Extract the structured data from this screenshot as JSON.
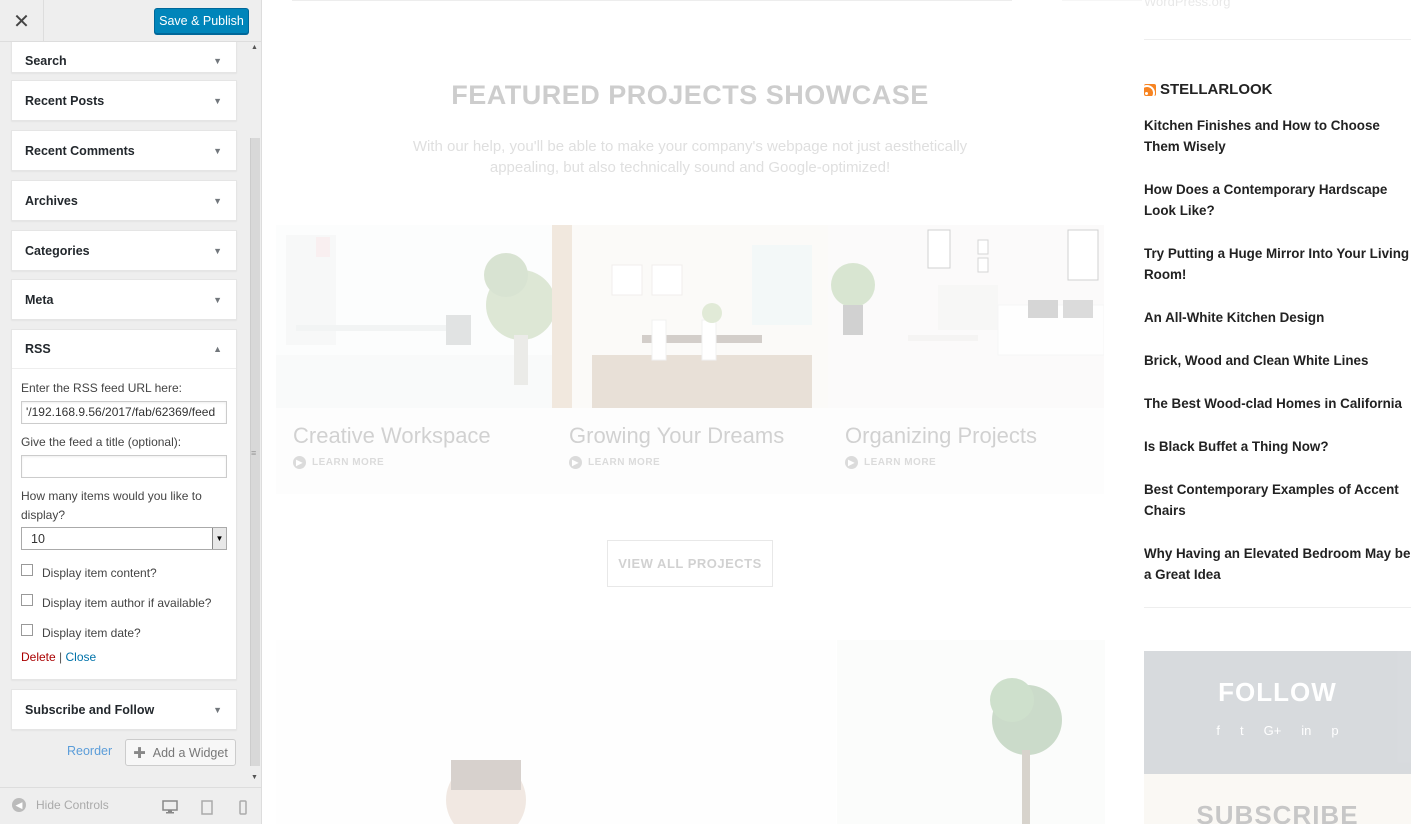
{
  "header": {
    "close_glyph": "✕",
    "save_label": "Save & Publish"
  },
  "widgets": [
    {
      "title": "Search",
      "arrow": "▼"
    },
    {
      "title": "Recent Posts",
      "arrow": "▼"
    },
    {
      "title": "Recent Comments",
      "arrow": "▼"
    },
    {
      "title": "Archives",
      "arrow": "▼"
    },
    {
      "title": "Categories",
      "arrow": "▼"
    },
    {
      "title": "Meta",
      "arrow": "▼"
    }
  ],
  "rss_widget": {
    "title": "RSS",
    "arrow": "▲",
    "url_label": "Enter the RSS feed URL here:",
    "url_value": "'/192.168.9.56/2017/fab/62369/feed",
    "title_label": "Give the feed a title (optional):",
    "title_value": "",
    "items_label": "How many items would you like to display?",
    "items_value": "10",
    "checkboxes": [
      {
        "label": "Display item content?",
        "checked": false
      },
      {
        "label": "Display item author if available?",
        "checked": false
      },
      {
        "label": "Display item date?",
        "checked": false
      }
    ],
    "delete_label": "Delete",
    "separator": "|",
    "close_label": "Close"
  },
  "subscribe_widget": {
    "title": "Subscribe and Follow",
    "arrow": "▼"
  },
  "actions": {
    "reorder_label": "Reorder",
    "add_widget_label": "Add a Widget"
  },
  "footer": {
    "hide_controls_label": "Hide Controls",
    "devices": [
      "desktop",
      "tablet",
      "mobile"
    ]
  },
  "preview": {
    "showcase_title": "FEATURED PROJECTS SHOWCASE",
    "showcase_subtitle": "With our help, you'll be able to make your company's webpage not just aesthetically appealing, but also technically sound and Google-optimized!",
    "projects": [
      {
        "title": "Creative Workspace",
        "more": "LEARN MORE"
      },
      {
        "title": "Growing Your Dreams",
        "more": "LEARN MORE"
      },
      {
        "title": "Organizing Projects",
        "more": "LEARN MORE"
      }
    ],
    "view_all_label": "VIEW ALL PROJECTS",
    "wordpress_link": "WordPress.org",
    "rss_feed_title": "STELLARLOOK",
    "rss_items": [
      "Kitchen Finishes and How to Choose Them Wisely",
      "How Does a Contemporary Hardscape Look Like?",
      "Try Putting a Huge Mirror Into Your Living Room!",
      "An All-White Kitchen Design",
      "Brick, Wood and Clean White Lines",
      "The Best Wood-clad Homes in California",
      "Is Black Buffet a Thing Now?",
      "Best Contemporary Examples of Accent Chairs",
      "Why Having an Elevated Bedroom May be a Great Idea"
    ],
    "follow_title": "FOLLOW",
    "follow_icons": [
      "f",
      "t",
      "G+",
      "in",
      "p"
    ],
    "subscribe_title": "SUBSCRIBE"
  },
  "colors": {
    "primary_button": "#0085ba",
    "delete_link": "#aa0000",
    "close_link": "#0073aa",
    "rss_orange": "#f78422"
  }
}
